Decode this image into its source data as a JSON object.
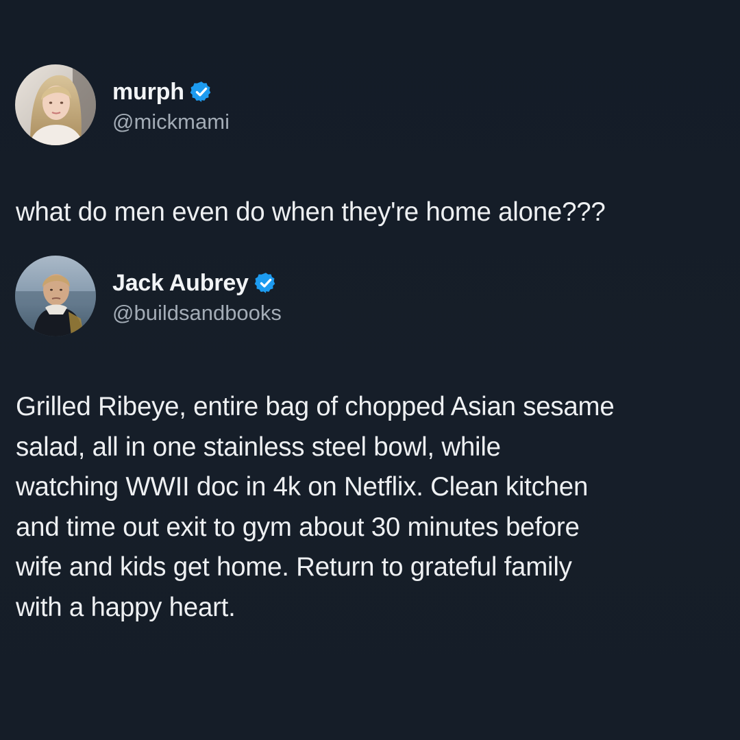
{
  "colors": {
    "background": "#151d28",
    "text": "#eef0f2",
    "handle": "#a3acb6",
    "verified_badge": "#1d9bf0"
  },
  "original_tweet": {
    "display_name": "murph",
    "handle": "@mickmami",
    "verified": true,
    "verified_icon": "verified-badge-icon",
    "text": "what do men even do when they're home alone???"
  },
  "reply_tweet": {
    "display_name": "Jack Aubrey",
    "handle": "@buildsandbooks",
    "verified": true,
    "verified_icon": "verified-badge-icon",
    "text_lines": [
      "Grilled Ribeye, entire bag of chopped Asian sesame",
      "salad, all in one stainless steel bowl, while",
      "watching WWII doc in 4k on Netflix. Clean kitchen",
      "and time out exit to gym about 30 minutes before",
      "wife and kids get home. Return to grateful family",
      "with a happy heart."
    ]
  }
}
